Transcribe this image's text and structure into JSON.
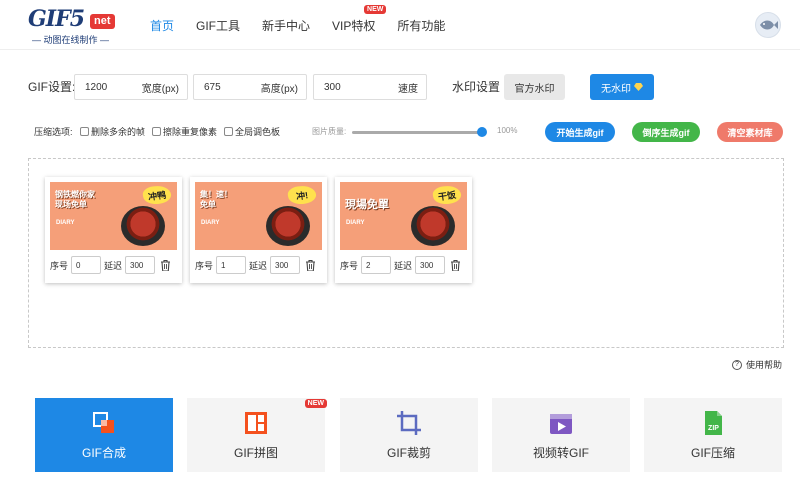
{
  "header": {
    "logo": "GIF5",
    "logo_net": "net",
    "logo_sub": "— 动图在线制作 —",
    "nav": [
      {
        "label": "首页",
        "active": true
      },
      {
        "label": "GIF工具"
      },
      {
        "label": "新手中心"
      },
      {
        "label": "VIP特权",
        "badge": "NEW"
      },
      {
        "label": "所有功能"
      }
    ]
  },
  "settings": {
    "gif_label": "GIF设置:",
    "width_value": "1200",
    "width_unit": "宽度(px)",
    "height_value": "675",
    "height_unit": "高度(px)",
    "speed_value": "300",
    "speed_unit": "速度",
    "watermark_label": "水印设置",
    "official_watermark": "官方水印",
    "no_watermark": "无水印"
  },
  "compress": {
    "label": "压缩选项:",
    "options": [
      "删除多余的帧",
      "擦除重复像素",
      "全局调色板"
    ],
    "quality_label": "图片质量:",
    "quality_value": "100%",
    "start_button": "开始生成gif",
    "reverse_button": "倒序生成gif",
    "clear_button": "清空素材库"
  },
  "frames": [
    {
      "title": "钢铁燃你家\n现场免单",
      "sub": "DIARY",
      "burst": "冲鸭",
      "seq_label": "序号",
      "seq": "0",
      "delay_label": "延迟",
      "delay": "300"
    },
    {
      "title": "集！速！\n免单",
      "sub": "DIARY",
      "burst": "冲!",
      "seq_label": "序号",
      "seq": "1",
      "delay_label": "延迟",
      "delay": "300"
    },
    {
      "title": "現場免單",
      "sub": "DIARY",
      "burst": "干饭",
      "seq_label": "序号",
      "seq": "2",
      "delay_label": "延迟",
      "delay": "300"
    }
  ],
  "help": "使用帮助",
  "tools": [
    {
      "label": "GIF合成",
      "icon": "merge-icon",
      "active": true
    },
    {
      "label": "GIF拼图",
      "icon": "puzzle-icon",
      "badge": "NEW"
    },
    {
      "label": "GIF裁剪",
      "icon": "crop-icon"
    },
    {
      "label": "视频转GIF",
      "icon": "video-icon"
    },
    {
      "label": "GIF压缩",
      "icon": "zip-icon"
    }
  ],
  "colors": {
    "accent": "#1e88e5",
    "green": "#43b649",
    "coral": "#ef7a6a",
    "thumb_bg": "#f59f79"
  }
}
